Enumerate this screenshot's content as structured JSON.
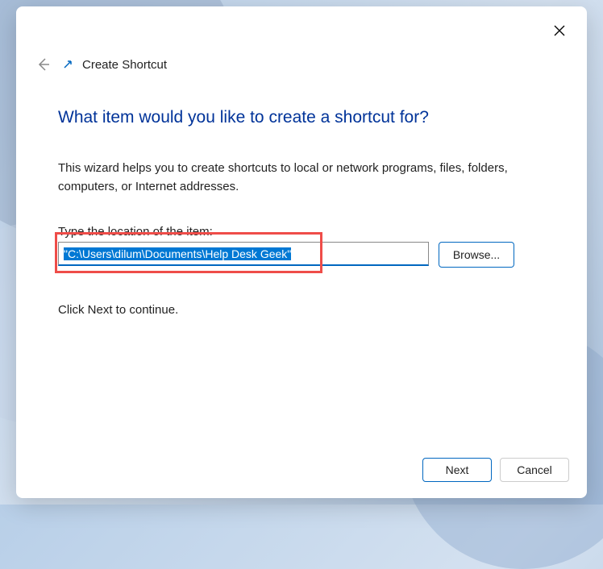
{
  "dialog": {
    "title": "Create Shortcut",
    "heading": "What item would you like to create a shortcut for?",
    "description": "This wizard helps you to create shortcuts to local or network programs, files, folders, computers, or Internet addresses.",
    "location_label": "Type the location of the item:",
    "location_value": "\"C:\\Users\\dilum\\Documents\\Help Desk Geek\"",
    "browse_label": "Browse...",
    "continue_text": "Click Next to continue.",
    "next_label": "Next",
    "cancel_label": "Cancel"
  }
}
